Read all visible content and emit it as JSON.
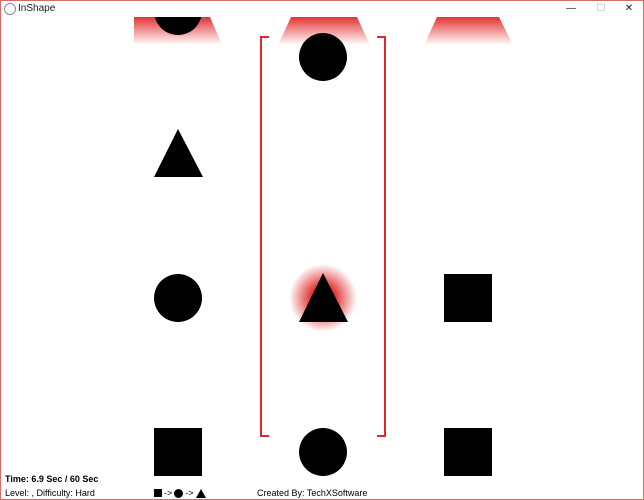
{
  "window": {
    "title": "InShape",
    "controls": {
      "minimize": "—",
      "maximize": "☐",
      "close": "✕"
    }
  },
  "game": {
    "columns": [
      {
        "shapes": [
          "circle",
          "triangle",
          "circle",
          "square"
        ]
      },
      {
        "shapes": [
          "circle",
          "triangle",
          "circle"
        ]
      },
      {
        "shapes": [
          "square",
          "square"
        ]
      }
    ],
    "active_column": 2,
    "highlighted_shape": "triangle",
    "accent_color": "#e0282a"
  },
  "hud": {
    "time": "Time: 6.9 Sec / 60 Sec",
    "level_difficulty": "Level: , Difficulty: Hard",
    "legend_order": [
      "square",
      "circle",
      "triangle"
    ],
    "legend_arrow": "->",
    "credit": "Created By: TechXSoftware"
  }
}
